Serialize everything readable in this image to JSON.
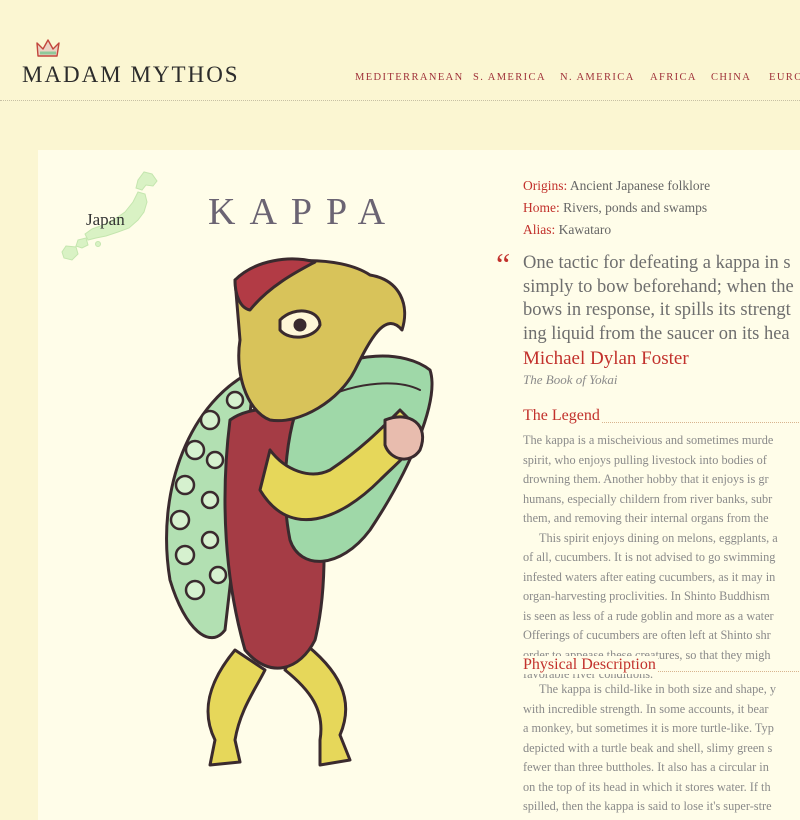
{
  "site": {
    "logo": "MADAM MYTHOS"
  },
  "nav": [
    "MEDITERRANEAN",
    "S. AMERICA",
    "N. AMERICA",
    "AFRICA",
    "CHINA",
    "EURO"
  ],
  "entry": {
    "map_label": "Japan",
    "title": "KAPPA",
    "facts": [
      {
        "key": "Origins:",
        "value": " Ancient Japanese folklore"
      },
      {
        "key": "Home:",
        "value": " Rivers, ponds and swamps"
      },
      {
        "key": "Alias:",
        "value": " Kawataro"
      }
    ],
    "quote": {
      "mark": "“",
      "lines": [
        "One tactic for defeating a kappa in s",
        "simply to bow beforehand; when the",
        "bows in response, it spills its strengt",
        "ing liquid from the saucer on its hea"
      ],
      "author": "Michael Dylan Foster",
      "source": "The Book of Yokai"
    },
    "legend": {
      "heading": "The Legend",
      "lines": [
        "The kappa is a mischeivious and sometimes murde",
        "spirit, who enjoys pulling livestock into bodies of",
        "drowning them. Another hobby that it enjoys is gr",
        "humans, especially childern from river banks, subr",
        "them, and removing their internal organs from the",
        "This spirit enjoys dining on melons, eggplants, a",
        "of all, cucumbers. It is not advised to go swimming",
        "infested waters after eating cucumbers, as it may in",
        "organ-harvesting proclivities. In Shinto Buddhism",
        "is seen as less of a rude goblin and more as a water",
        "Offerings of cucumbers are often left at Shinto shr",
        "order to appease these creatures, so that they migh",
        "favorable river conditions."
      ]
    },
    "physical": {
      "heading": "Physical Description",
      "lines": [
        "The kappa is child-like in both size and shape, y",
        "with incredible strength. In some accounts, it bear",
        "a monkey, but sometimes it is more turtle-like. Typ",
        "depicted with a turtle beak and shell, slimy green s",
        "fewer than three buttholes. It also has a circular in",
        "on the top of its head in which it stores water. If th",
        "spilled, then the kappa is said to lose it's super-stre"
      ]
    }
  }
}
